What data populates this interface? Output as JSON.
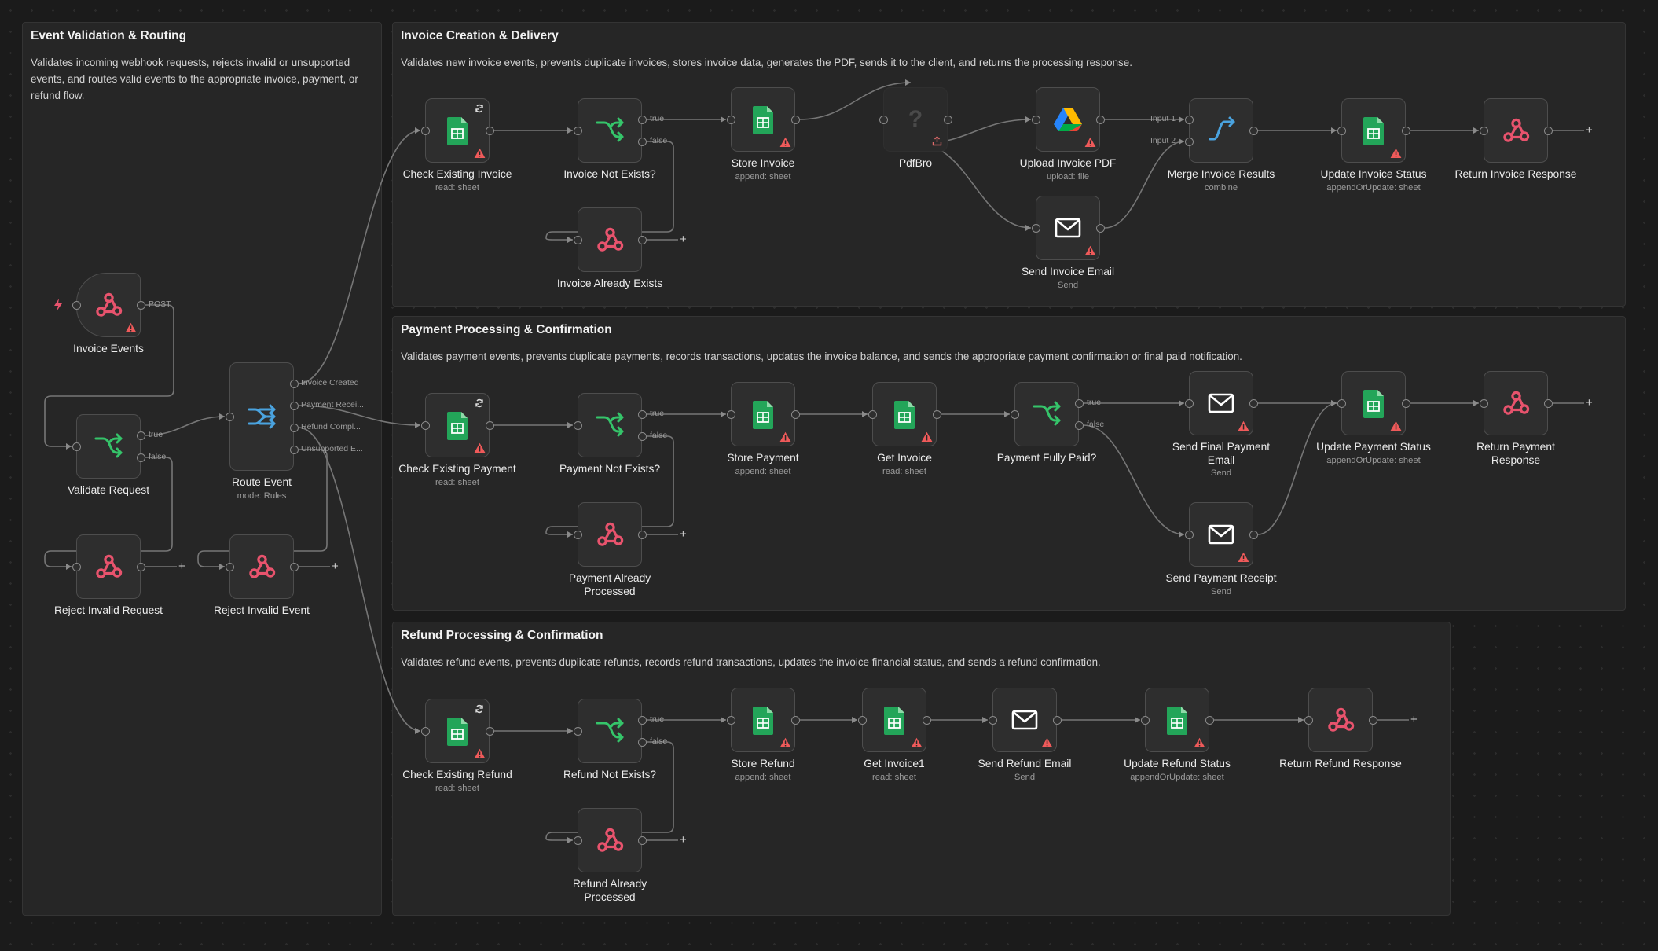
{
  "groups": [
    {
      "title": "Event Validation & Routing",
      "desc": "Validates incoming webhook requests, rejects invalid or unsupported events, and routes valid events to the appropriate invoice, payment, or refund flow."
    },
    {
      "title": "Invoice Creation & Delivery",
      "desc": "Validates new invoice events, prevents duplicate invoices, stores invoice data, generates the PDF, sends it to the client, and returns the processing response."
    },
    {
      "title": "Payment Processing & Confirmation",
      "desc": "Validates payment events, prevents duplicate payments, records transactions, updates the invoice balance, and sends the appropriate payment confirmation or final paid notification."
    },
    {
      "title": "Refund Processing & Confirmation",
      "desc": "Validates refund events, prevents duplicate refunds, records refund transactions, updates the invoice financial status, and sends a refund confirmation."
    }
  ],
  "nodes": [
    {
      "label": "Invoice Events",
      "sub": "",
      "icon": "webhook-icon"
    },
    {
      "label": "Validate Request",
      "sub": "",
      "icon": "if-icon"
    },
    {
      "label": "Reject Invalid Request",
      "sub": "",
      "icon": "webhook-icon"
    },
    {
      "label": "Route Event",
      "sub": "mode: Rules",
      "icon": "switch-icon"
    },
    {
      "label": "Reject Invalid Event",
      "sub": "",
      "icon": "webhook-icon"
    },
    {
      "label": "Check Existing Invoice",
      "sub": "read: sheet",
      "icon": "sheets-icon"
    },
    {
      "label": "Invoice Not Exists?",
      "sub": "",
      "icon": "if-icon"
    },
    {
      "label": "Invoice Already Exists",
      "sub": "",
      "icon": "webhook-icon"
    },
    {
      "label": "Store Invoice",
      "sub": "append: sheet",
      "icon": "sheets-icon"
    },
    {
      "label": "PdfBro",
      "sub": "",
      "icon": "unknown-icon"
    },
    {
      "label": "Upload Invoice PDF",
      "sub": "upload: file",
      "icon": "drive-icon"
    },
    {
      "label": "Send Invoice Email",
      "sub": "Send",
      "icon": "mail-icon"
    },
    {
      "label": "Merge Invoice Results",
      "sub": "combine",
      "icon": "merge-icon"
    },
    {
      "label": "Update Invoice Status",
      "sub": "appendOrUpdate: sheet",
      "icon": "sheets-icon"
    },
    {
      "label": "Return Invoice Response",
      "sub": "",
      "icon": "webhook-icon"
    },
    {
      "label": "Check Existing Payment",
      "sub": "read: sheet",
      "icon": "sheets-icon"
    },
    {
      "label": "Payment Not Exists?",
      "sub": "",
      "icon": "if-icon"
    },
    {
      "label": "Payment Already Processed",
      "sub": "",
      "icon": "webhook-icon"
    },
    {
      "label": "Store Payment",
      "sub": "append: sheet",
      "icon": "sheets-icon"
    },
    {
      "label": "Get Invoice",
      "sub": "read: sheet",
      "icon": "sheets-icon"
    },
    {
      "label": "Payment Fully Paid?",
      "sub": "",
      "icon": "if-icon"
    },
    {
      "label": "Send Final Payment Email",
      "sub": "Send",
      "icon": "mail-icon"
    },
    {
      "label": "Send Payment Receipt",
      "sub": "Send",
      "icon": "mail-icon"
    },
    {
      "label": "Update Payment Status",
      "sub": "appendOrUpdate: sheet",
      "icon": "sheets-icon"
    },
    {
      "label": "Return Payment Response",
      "sub": "",
      "icon": "webhook-icon"
    },
    {
      "label": "Check Existing Refund",
      "sub": "read: sheet",
      "icon": "sheets-icon"
    },
    {
      "label": "Refund Not Exists?",
      "sub": "",
      "icon": "if-icon"
    },
    {
      "label": "Refund Already Processed",
      "sub": "",
      "icon": "webhook-icon"
    },
    {
      "label": "Store Refund",
      "sub": "append: sheet",
      "icon": "sheets-icon"
    },
    {
      "label": "Get Invoice1",
      "sub": "read: sheet",
      "icon": "sheets-icon"
    },
    {
      "label": "Send Refund Email",
      "sub": "Send",
      "icon": "mail-icon"
    },
    {
      "label": "Update Refund Status",
      "sub": "appendOrUpdate: sheet",
      "icon": "sheets-icon"
    },
    {
      "label": "Return Refund Response",
      "sub": "",
      "icon": "webhook-icon"
    }
  ],
  "ports": {
    "post": "POST",
    "true": "true",
    "false": "false",
    "input1": "Input 1",
    "input2": "Input 2",
    "route_invoice_created": "Invoice Created",
    "route_payment": "Payment Recei...",
    "route_refund": "Refund Compl...",
    "route_unsupported": "Unsupported E..."
  },
  "colors": {
    "webhook": "#e8536d",
    "sheets": "#23a559",
    "if": "#35c46a",
    "switch": "#4aa3df",
    "warning": "#ef5a5a"
  }
}
